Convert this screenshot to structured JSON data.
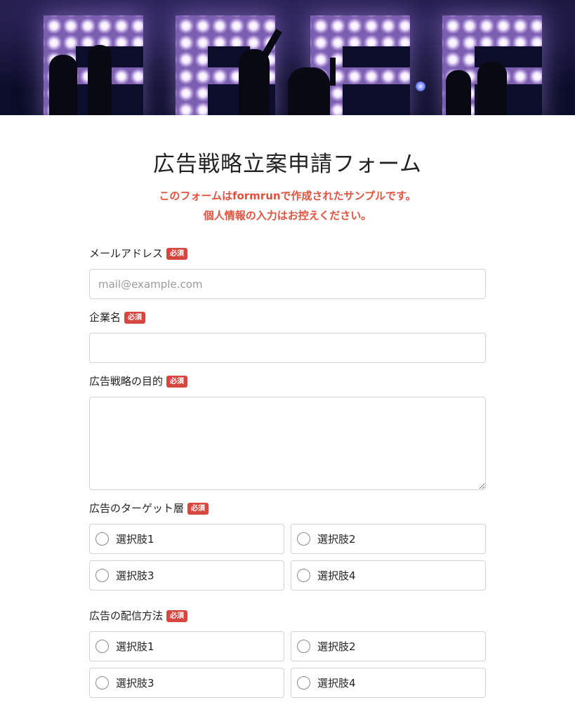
{
  "hero": {
    "image_description_icon": "stage-lights-banner-image"
  },
  "form": {
    "title": "広告戦略立案申請フォーム",
    "notice_line1": "このフォームはformrunで作成されたサンプルです。",
    "notice_line2": "個人情報の入力はお控えください。",
    "required_badge": "必須",
    "fields": {
      "email": {
        "label": "メールアドレス",
        "placeholder": "mail@example.com",
        "value": ""
      },
      "company": {
        "label": "企業名",
        "value": ""
      },
      "purpose": {
        "label": "広告戦略の目的",
        "value": ""
      },
      "target": {
        "label": "広告のターゲット層",
        "options": [
          "選択肢1",
          "選択肢2",
          "選択肢3",
          "選択肢4"
        ]
      },
      "delivery": {
        "label": "広告の配信方法",
        "options": [
          "選択肢1",
          "選択肢2",
          "選択肢3",
          "選択肢4"
        ]
      }
    }
  },
  "colors": {
    "accent_red": "#e0533f",
    "badge_red": "#d6473f",
    "border_gray": "#d3d3d3",
    "hero_dark": "#0c0d2a",
    "hero_light_purple": "#b49ad8"
  }
}
